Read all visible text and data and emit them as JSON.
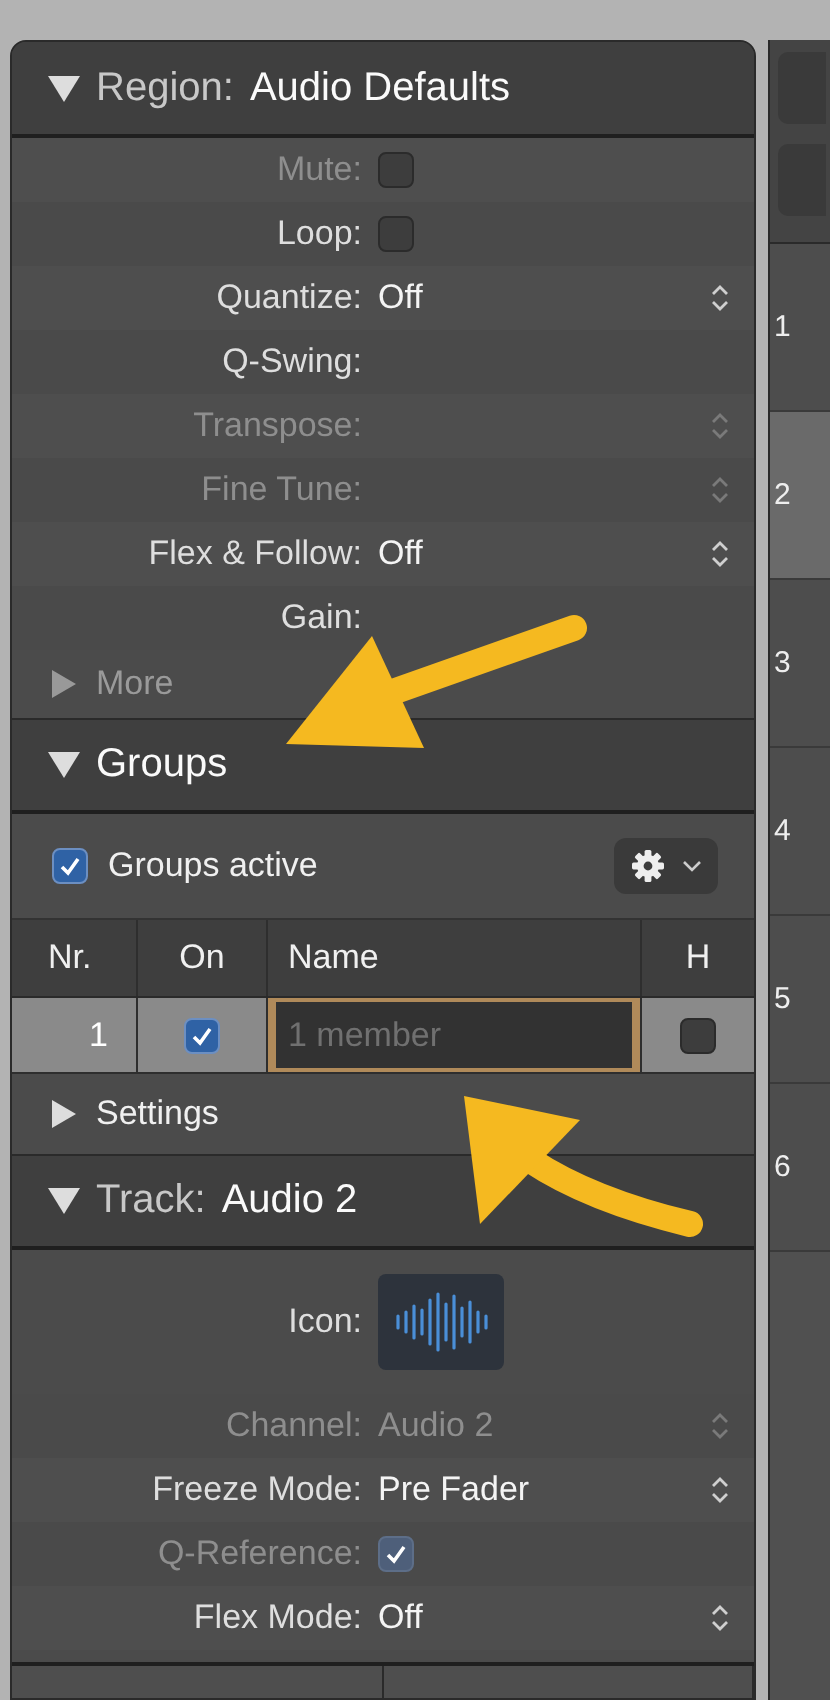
{
  "region": {
    "label": "Region:",
    "name": "Audio Defaults",
    "expanded": true,
    "rows": [
      {
        "kind": "checkbox",
        "label": "Mute:",
        "checked": false,
        "disabled": true
      },
      {
        "kind": "checkbox",
        "label": "Loop:",
        "checked": false,
        "disabled": false
      },
      {
        "kind": "popup",
        "label": "Quantize:",
        "value": "Off",
        "disabled": false
      },
      {
        "kind": "text",
        "label": "Q-Swing:",
        "disabled": false
      },
      {
        "kind": "popup",
        "label": "Transpose:",
        "disabled": true
      },
      {
        "kind": "popup",
        "label": "Fine Tune:",
        "disabled": true
      },
      {
        "kind": "popup",
        "label": "Flex & Follow:",
        "value": "Off",
        "disabled": false
      },
      {
        "kind": "text",
        "label": "Gain:",
        "disabled": false
      }
    ],
    "more": {
      "label": "More",
      "expanded": false
    }
  },
  "groups": {
    "title": "Groups",
    "expanded": true,
    "active": {
      "label": "Groups active",
      "checked": true
    },
    "columns": [
      "Nr.",
      "On",
      "Name",
      "H"
    ],
    "rows": [
      {
        "nr": "1",
        "on": true,
        "placeholder": "1 member",
        "hide": false,
        "selected": true
      }
    ],
    "settings": {
      "label": "Settings",
      "expanded": false
    }
  },
  "track": {
    "label": "Track:",
    "name": "Audio 2",
    "expanded": true,
    "rows": [
      {
        "kind": "icon",
        "label": "Icon:",
        "disabled": false
      },
      {
        "kind": "popup",
        "label": "Channel:",
        "value": "Audio 2",
        "disabled": true
      },
      {
        "kind": "popup",
        "label": "Freeze Mode:",
        "value": "Pre Fader",
        "disabled": false
      },
      {
        "kind": "checkbox",
        "label": "Q-Reference:",
        "checked": true,
        "disabled": true
      },
      {
        "kind": "popup",
        "label": "Flex Mode:",
        "value": "Off",
        "disabled": false
      }
    ]
  },
  "track_list": [
    {
      "label": "1",
      "selected": false
    },
    {
      "label": "2",
      "selected": true
    },
    {
      "label": "3",
      "selected": false
    },
    {
      "label": "4",
      "selected": false
    },
    {
      "label": "5",
      "selected": false
    },
    {
      "label": "6",
      "selected": false
    }
  ],
  "annotations": [
    {
      "kind": "straight"
    },
    {
      "kind": "curved"
    }
  ]
}
